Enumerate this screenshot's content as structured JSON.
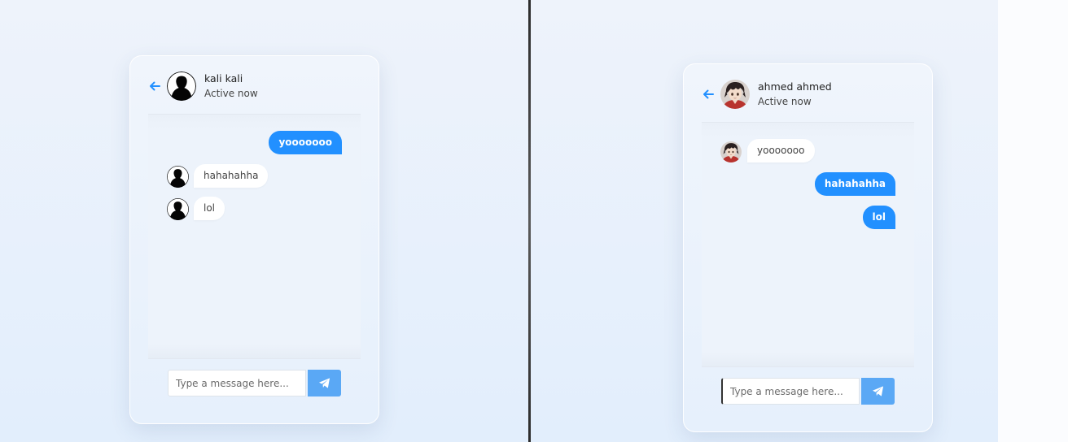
{
  "colors": {
    "accent": "#2290ff",
    "send_button": "#5aa8f5",
    "background": "#e8f1fc",
    "divider": "#3a3a3a"
  },
  "left_chat": {
    "contact_name": "kali kali",
    "status": "Active now",
    "avatar": "silhouette-avatar",
    "messages": [
      {
        "direction": "outgoing",
        "text": "yooooooo"
      },
      {
        "direction": "incoming",
        "text": "hahahahha"
      },
      {
        "direction": "incoming",
        "text": "lol"
      }
    ],
    "input_placeholder": "Type a message here...",
    "send_icon": "paper-plane-icon"
  },
  "right_chat": {
    "contact_name": "ahmed ahmed",
    "status": "Active now",
    "avatar": "anime-character-avatar",
    "messages": [
      {
        "direction": "incoming",
        "text": "yooooooo"
      },
      {
        "direction": "outgoing",
        "text": "hahahahha"
      },
      {
        "direction": "outgoing",
        "text": "lol"
      }
    ],
    "input_placeholder": "Type a message here...",
    "send_icon": "paper-plane-icon"
  }
}
